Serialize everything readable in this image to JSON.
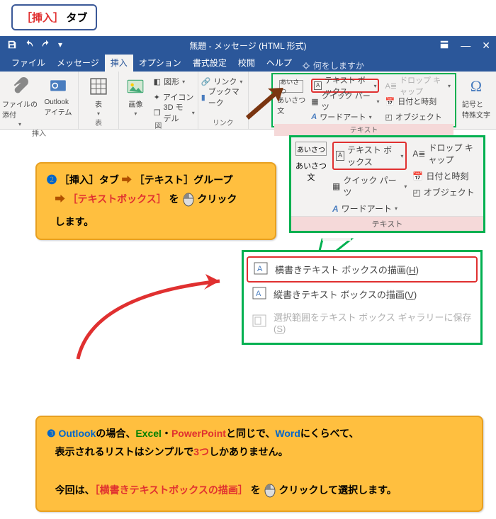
{
  "callout_top": {
    "insert_label": "［挿入］",
    "tab_label": "タブ"
  },
  "titlebar": {
    "title": "無題 - メッセージ (HTML 形式)"
  },
  "tabs": {
    "file": "ファイル",
    "message": "メッセージ",
    "insert": "挿入",
    "option": "オプション",
    "format": "書式設定",
    "review": "校閲",
    "help": "ヘルプ",
    "tell": "何をしますか"
  },
  "ribbon": {
    "group_include": {
      "attach_file": "ファイルの\n添付",
      "outlook_item": "Outlook\nアイテム",
      "label": "挿入"
    },
    "group_table": {
      "table": "表",
      "label": "表"
    },
    "group_image": {
      "image": "画像",
      "shapes": "図形",
      "icons": "アイコン",
      "model3d": "3D モデル",
      "label": "図"
    },
    "group_link": {
      "link": "リンク",
      "bookmark": "ブックマーク",
      "label": "リンク"
    },
    "group_text": {
      "greeting_small": "あいさつ",
      "greeting": "あいさつ\n文",
      "textbox": "テキスト ボックス",
      "quickparts": "クイック パーツ",
      "wordart": "ワードアート",
      "dropcap": "ドロップ キャップ",
      "datetime": "日付と時刻",
      "object": "オブジェクト",
      "label": "テキスト"
    },
    "group_symbol": {
      "symbol": "記号と\n特殊文字",
      "label": ""
    }
  },
  "enlarged": {
    "greeting_small": "あいさつ",
    "greeting": "あいさつ\n文",
    "textbox": "テキスト ボックス",
    "quickparts": "クイック パーツ",
    "wordart": "ワードアート",
    "dropcap": "ドロップ キャップ",
    "datetime": "日付と時刻",
    "object": "オブジェクト",
    "label": "テキスト"
  },
  "step2": {
    "num": "❷",
    "l1a": "［挿入］タブ",
    "l1b": "［テキスト］グループ",
    "l2a": "［テキストボックス］",
    "l2b": "を",
    "l2c": "クリック",
    "l3": "します。"
  },
  "menu": {
    "horiz": "横書きテキスト ボックスの描画(",
    "horiz_key": "H",
    "vert": "縦書きテキスト ボックスの描画(",
    "vert_key": "V",
    "save": "選択範囲をテキスト ボックス ギャラリーに保存(",
    "save_key": "S",
    "close": ")"
  },
  "step3": {
    "num": "❸",
    "p1a": "Outlook",
    "p1b": "の場合、",
    "p1c": "Excel",
    "p1d": "・",
    "p1e": "PowerPoint",
    "p1f": "と同じで、",
    "p1g": "Word",
    "p1h": "にくらべて、",
    "p2a": "表示されるリストはシンプルで",
    "p2b": "3つ",
    "p2c": "しかありません。",
    "p3a": "今回は、",
    "p3b": "［横書きテキストボックスの描画］",
    "p3c": "を",
    "p3d": "クリック",
    "p3e": "して選択します。"
  }
}
